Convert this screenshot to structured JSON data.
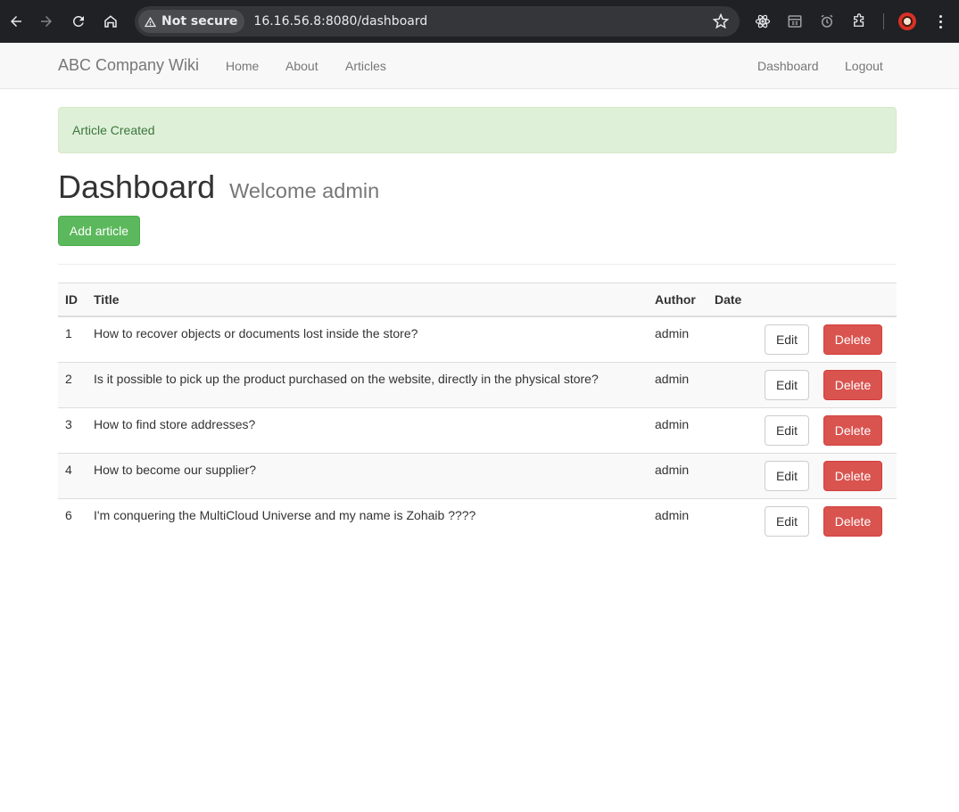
{
  "browser": {
    "security_label": "Not secure",
    "url": "16.16.56.8:8080/dashboard"
  },
  "navbar": {
    "brand": "ABC Company Wiki",
    "left_links": [
      "Home",
      "About",
      "Articles"
    ],
    "right_links": [
      "Dashboard",
      "Logout"
    ]
  },
  "alert": {
    "message": "Article Created"
  },
  "page": {
    "title": "Dashboard",
    "subtitle": "Welcome admin",
    "add_button": "Add article"
  },
  "table": {
    "headers": {
      "id": "ID",
      "title": "Title",
      "author": "Author",
      "date": "Date"
    },
    "edit_label": "Edit",
    "delete_label": "Delete",
    "rows": [
      {
        "id": "1",
        "title": "How to recover objects or documents lost inside the store?",
        "author": "admin",
        "date": ""
      },
      {
        "id": "2",
        "title": "Is it possible to pick up the product purchased on the website, directly in the physical store?",
        "author": "admin",
        "date": ""
      },
      {
        "id": "3",
        "title": "How to find store addresses?",
        "author": "admin",
        "date": ""
      },
      {
        "id": "4",
        "title": "How to become our supplier?",
        "author": "admin",
        "date": ""
      },
      {
        "id": "6",
        "title": "I'm conquering the MultiCloud Universe and my name is Zohaib ????",
        "author": "admin",
        "date": ""
      }
    ]
  },
  "colors": {
    "success": "#5cb85c",
    "danger": "#d9534f",
    "alert_bg": "#dff0d8",
    "alert_text": "#3c763d",
    "chrome_bg": "#202124"
  }
}
